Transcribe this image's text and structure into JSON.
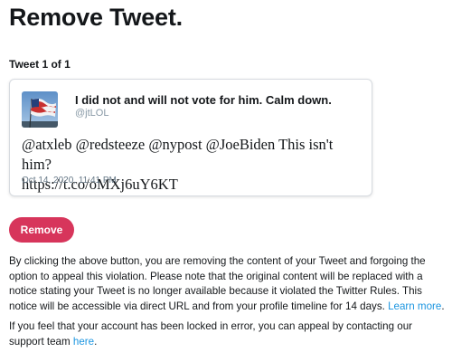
{
  "page": {
    "title": "Remove Tweet.",
    "tweet_count": "Tweet 1 of 1"
  },
  "tweet": {
    "user_name": "I did not and will not vote for him. Calm down.",
    "handle": "@jtLOL",
    "text_line1": "@atxleb @redsteeze @nypost @JoeBiden This isn't him?",
    "text_line2": "https://t.co/oMXj6uY6KT",
    "timestamp": "Oct 14, 2020, 11:41 PM",
    "avatar_icon": "flag-avatar-icon"
  },
  "actions": {
    "remove_label": "Remove"
  },
  "info": {
    "paragraph1_text": "By clicking the above button, you are removing the content of your Tweet and forgoing the option to appeal this violation. Please note that the original content will be replaced with a notice stating your Tweet is no longer available because it violated the Twitter Rules. This notice will be accessible via direct URL and from your profile timeline for 14 days. ",
    "paragraph1_link": "Learn more",
    "paragraph1_end": ".",
    "paragraph2_text": "If you feel that your account has been locked in error, you can appeal by contacting our support team ",
    "paragraph2_link": "here",
    "paragraph2_end": "."
  },
  "colors": {
    "remove_button": "#d7355b",
    "link": "#1b95e0",
    "handle": "#8899a6"
  }
}
